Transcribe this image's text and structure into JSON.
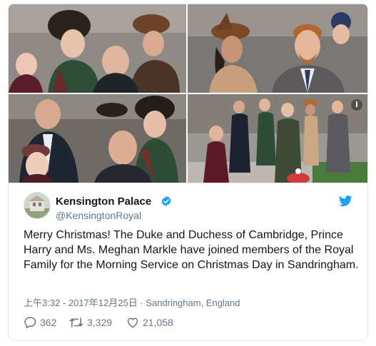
{
  "tweet": {
    "display_name": "Kensington Palace",
    "handle": "@KensingtonRoyal",
    "text": "Merry Christmas! The Duke and Duchess of Cambridge, Prince Harry and Ms. Meghan Markle have joined members of the Royal Family for the Morning Service on Christmas Day in Sandringham.",
    "timestamp": "上午3:32 - 2017年12月25日 · Sandringham, England",
    "replies": "362",
    "retweets": "3,329",
    "likes": "21,058"
  },
  "media": {
    "info_icon": "i",
    "photos": [
      {
        "name": "photo-crowd-1"
      },
      {
        "name": "photo-couple"
      },
      {
        "name": "photo-crowd-2"
      },
      {
        "name": "photo-walkway"
      }
    ]
  },
  "colors": {
    "twitter_blue": "#1da1f2",
    "text_primary": "#14171a",
    "text_secondary": "#657786",
    "border": "#e1e8ed"
  },
  "icons": {
    "verified": "verified-badge-icon",
    "bird": "twitter-bird-icon",
    "reply": "reply-icon",
    "retweet": "retweet-icon",
    "like": "heart-icon",
    "info": "info-icon"
  }
}
